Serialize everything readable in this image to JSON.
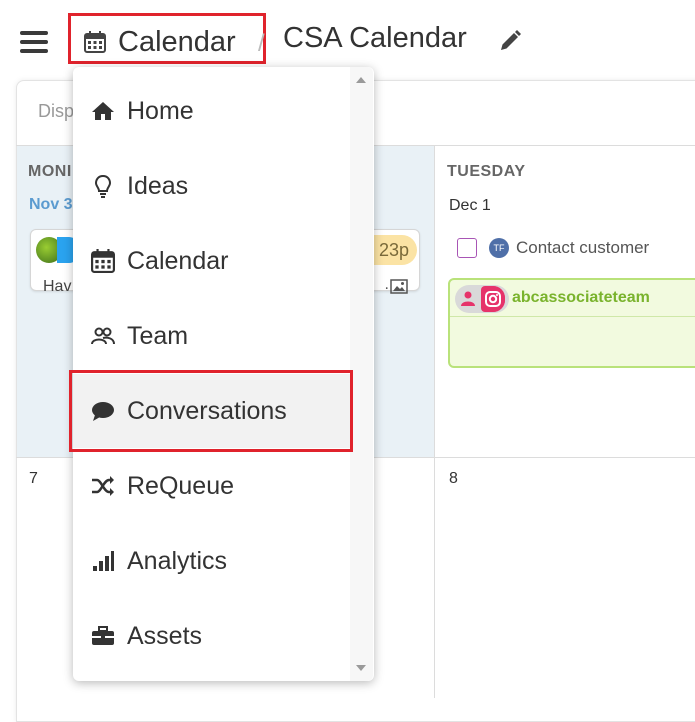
{
  "header": {
    "menu_icon": "hamburger-icon",
    "breadcrumb_section": "Calendar",
    "breadcrumb_section_icon": "calendar-icon",
    "page_title": "CSA Calendar",
    "edit_icon": "pencil-icon",
    "highlight_color": "#e0232c"
  },
  "calendar": {
    "toolbar_text": "Disp",
    "monday": {
      "day_label": "MONI",
      "date": "Nov 3",
      "post": {
        "avatar_icon": "user-avatar",
        "network_icon": "twitter-icon",
        "time": "23p",
        "text": "Hav",
        "ellipsis": ".",
        "media_icon": "image-icon"
      }
    },
    "tuesday": {
      "day_label": "TUESDAY",
      "date": "Dec 1",
      "task": {
        "initials": "TF",
        "label": "Contact customer"
      },
      "post": {
        "user_icon": "user-icon",
        "network_icon": "instagram-icon",
        "account": "abcassociateteam"
      }
    },
    "week2": {
      "mon_date": "7",
      "tue_date": "8"
    }
  },
  "menu": {
    "items": [
      {
        "label": "Home",
        "icon": "home-icon"
      },
      {
        "label": "Ideas",
        "icon": "lightbulb-icon"
      },
      {
        "label": "Calendar",
        "icon": "calendar-icon"
      },
      {
        "label": "Team",
        "icon": "team-icon"
      },
      {
        "label": "Conversations",
        "icon": "chat-bubble-icon",
        "highlighted": true
      },
      {
        "label": "ReQueue",
        "icon": "shuffle-icon"
      },
      {
        "label": "Analytics",
        "icon": "bar-chart-icon"
      },
      {
        "label": "Assets",
        "icon": "briefcase-icon"
      }
    ]
  }
}
